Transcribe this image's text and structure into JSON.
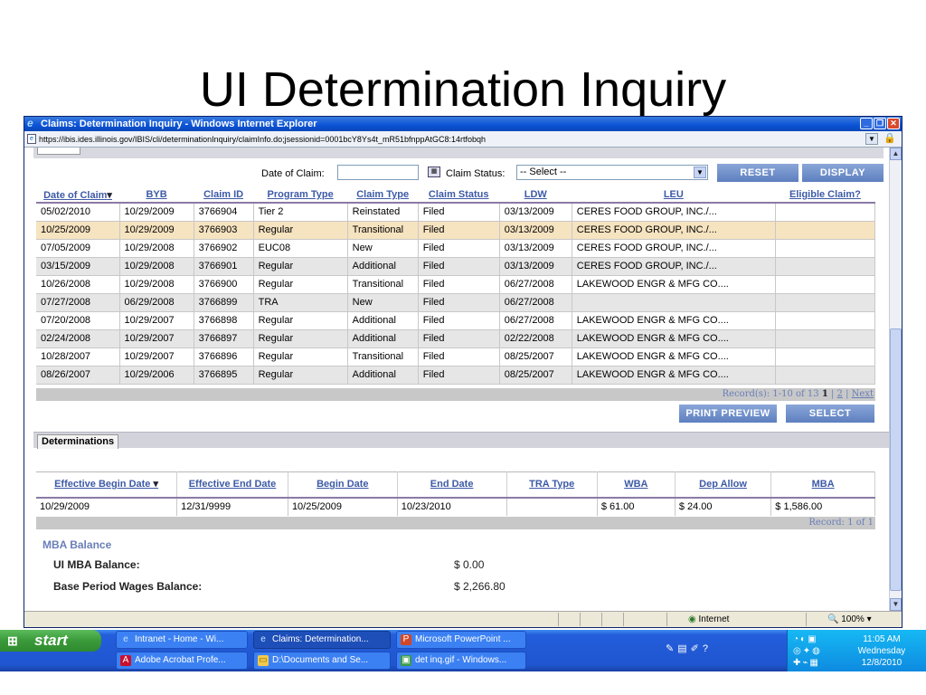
{
  "slide_title": "UI Determination Inquiry",
  "window": {
    "title": "Claims: Determination Inquiry - Windows Internet Explorer",
    "url": "https://ibis.ides.illinois.gov/IBIS/cli/determinationInquiry/claimInfo.do;jsessionid=0001bcY8Ys4t_mR51bfnppAtGC8:14rtfobqh"
  },
  "filters": {
    "date_label": "Date of Claim:",
    "status_label": "Claim Status:",
    "status_selected": "-- Select --",
    "reset_label": "RESET",
    "display_label": "DISPLAY"
  },
  "claims_table": {
    "headers": [
      "Date of Claim",
      "BYB",
      "Claim ID",
      "Program Type",
      "Claim Type",
      "Claim Status",
      "LDW",
      "LEU",
      "Eligible Claim?"
    ],
    "rows": [
      [
        "05/02/2010",
        "10/29/2009",
        "3766904",
        "Tier 2",
        "Reinstated",
        "Filed",
        "03/13/2009",
        "CERES FOOD GROUP, INC./...",
        ""
      ],
      [
        "10/25/2009",
        "10/29/2009",
        "3766903",
        "Regular",
        "Transitional",
        "Filed",
        "03/13/2009",
        "CERES FOOD GROUP, INC./...",
        ""
      ],
      [
        "07/05/2009",
        "10/29/2008",
        "3766902",
        "EUC08",
        "New",
        "Filed",
        "03/13/2009",
        "CERES FOOD GROUP, INC./...",
        ""
      ],
      [
        "03/15/2009",
        "10/29/2008",
        "3766901",
        "Regular",
        "Additional",
        "Filed",
        "03/13/2009",
        "CERES FOOD GROUP, INC./...",
        ""
      ],
      [
        "10/26/2008",
        "10/29/2008",
        "3766900",
        "Regular",
        "Transitional",
        "Filed",
        "06/27/2008",
        "LAKEWOOD ENGR & MFG CO....",
        ""
      ],
      [
        "07/27/2008",
        "06/29/2008",
        "3766899",
        "TRA",
        "New",
        "Filed",
        "06/27/2008",
        "",
        ""
      ],
      [
        "07/20/2008",
        "10/29/2007",
        "3766898",
        "Regular",
        "Additional",
        "Filed",
        "06/27/2008",
        "LAKEWOOD ENGR & MFG CO....",
        ""
      ],
      [
        "02/24/2008",
        "10/29/2007",
        "3766897",
        "Regular",
        "Additional",
        "Filed",
        "02/22/2008",
        "LAKEWOOD ENGR & MFG CO....",
        ""
      ],
      [
        "10/28/2007",
        "10/29/2007",
        "3766896",
        "Regular",
        "Transitional",
        "Filed",
        "08/25/2007",
        "LAKEWOOD ENGR & MFG CO....",
        ""
      ],
      [
        "08/26/2007",
        "10/29/2006",
        "3766895",
        "Regular",
        "Additional",
        "Filed",
        "08/25/2007",
        "LAKEWOOD ENGR & MFG CO....",
        ""
      ]
    ],
    "records_text": "Record(s): 1-10 of 13",
    "page_current": "1",
    "page_sep": "|",
    "page_next_num": "2",
    "page_next": "Next",
    "print_preview_label": "PRINT PREVIEW",
    "select_label": "SELECT"
  },
  "determinations": {
    "tab_label": "Determinations",
    "headers": [
      "Effective Begin Date",
      "Effective End Date",
      "Begin Date",
      "End Date",
      "TRA Type",
      "WBA",
      "Dep Allow",
      "MBA"
    ],
    "rows": [
      [
        "10/29/2009",
        "12/31/9999",
        "10/25/2009",
        "10/23/2010",
        "",
        "$ 61.00",
        "$ 24.00",
        "$ 1,586.00"
      ]
    ],
    "records_text": "Record: 1 of 1"
  },
  "mba": {
    "title": "MBA Balance",
    "ui_label": "UI MBA Balance:",
    "ui_value": "$ 0.00",
    "bpw_label": "Base Period Wages Balance:",
    "bpw_value": "$ 2,266.80"
  },
  "statusbar": {
    "zone": "Internet",
    "zoom": "100%"
  },
  "taskbar": {
    "start_label": "start",
    "tasks": [
      "Intranet - Home - Wi...",
      "Claims: Determination...",
      "Microsoft PowerPoint ...",
      "Adobe Acrobat Profe...",
      "D:\\Documents and Se...",
      "det inq.gif - Windows..."
    ],
    "time": "11:05 AM",
    "day": "Wednesday",
    "date": "12/8/2010"
  }
}
